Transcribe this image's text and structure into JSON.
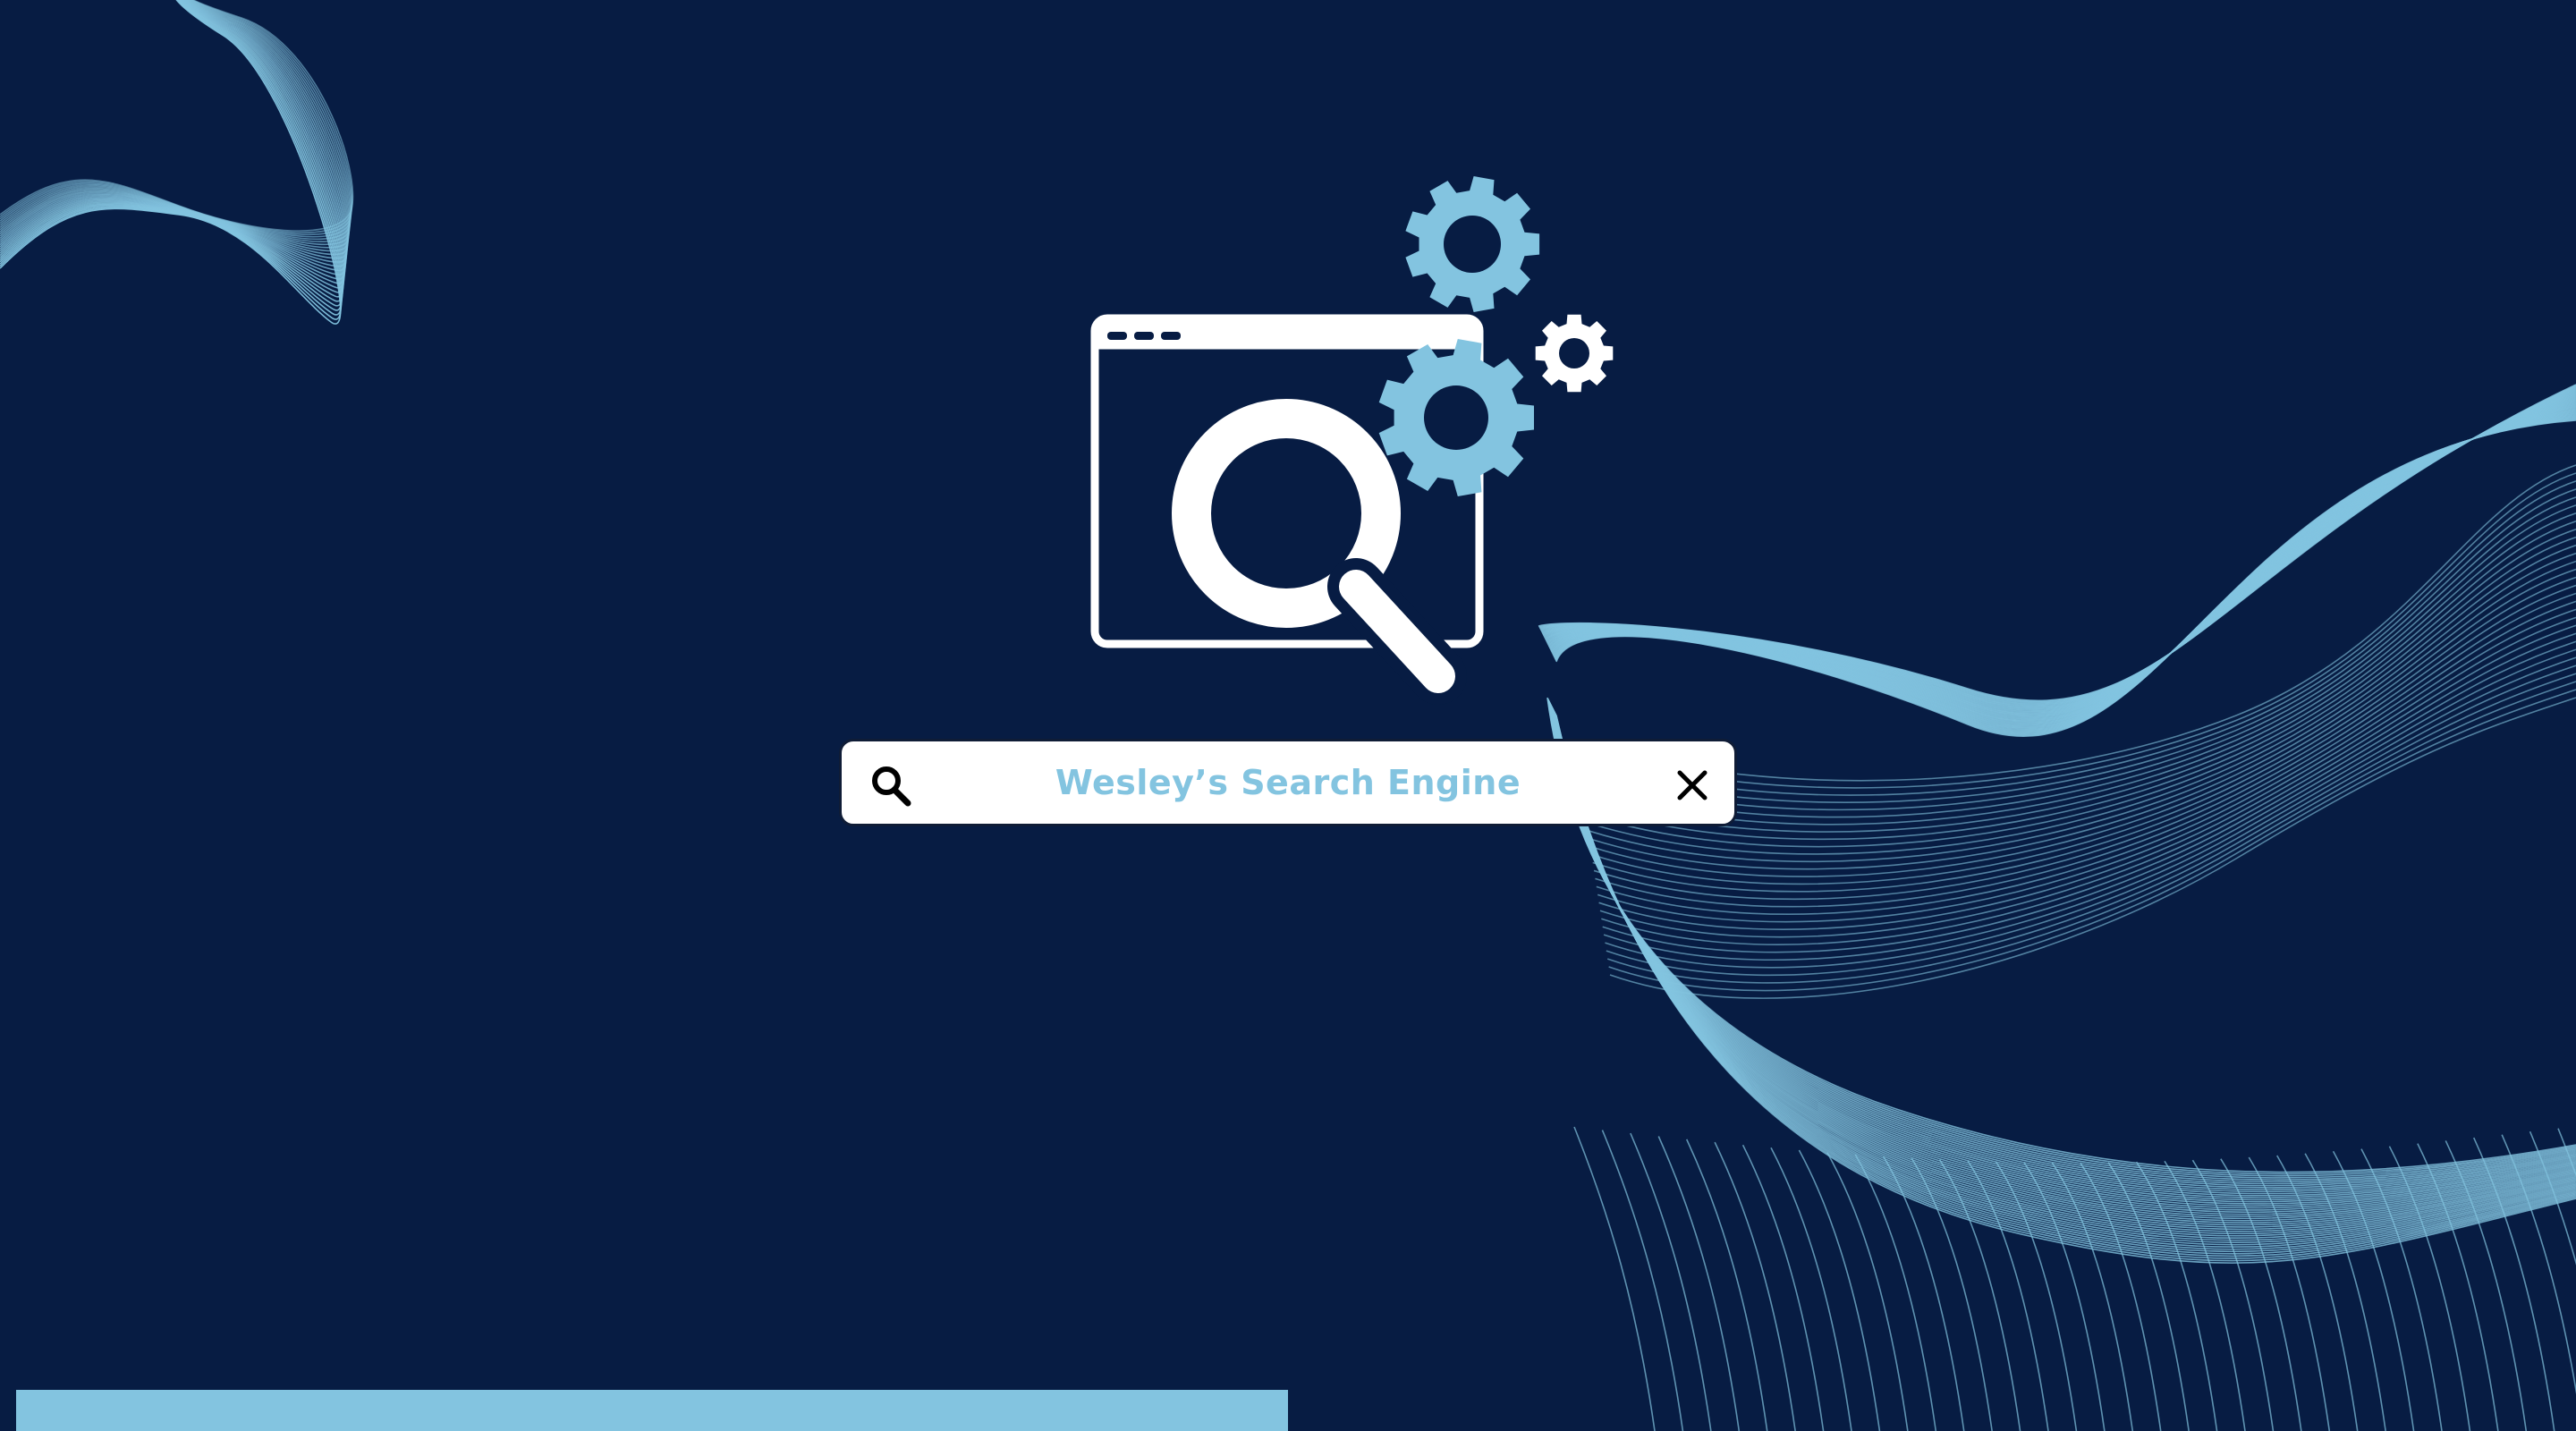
{
  "search": {
    "text": "Wesley’s Search Engine"
  },
  "icons": {
    "hero": "browser-window-with-magnifier-and-gears",
    "search": "search-icon",
    "clear": "close-icon"
  },
  "colors": {
    "background": "#071c43",
    "accent": "#83c4e0",
    "foreground": "#ffffff"
  }
}
